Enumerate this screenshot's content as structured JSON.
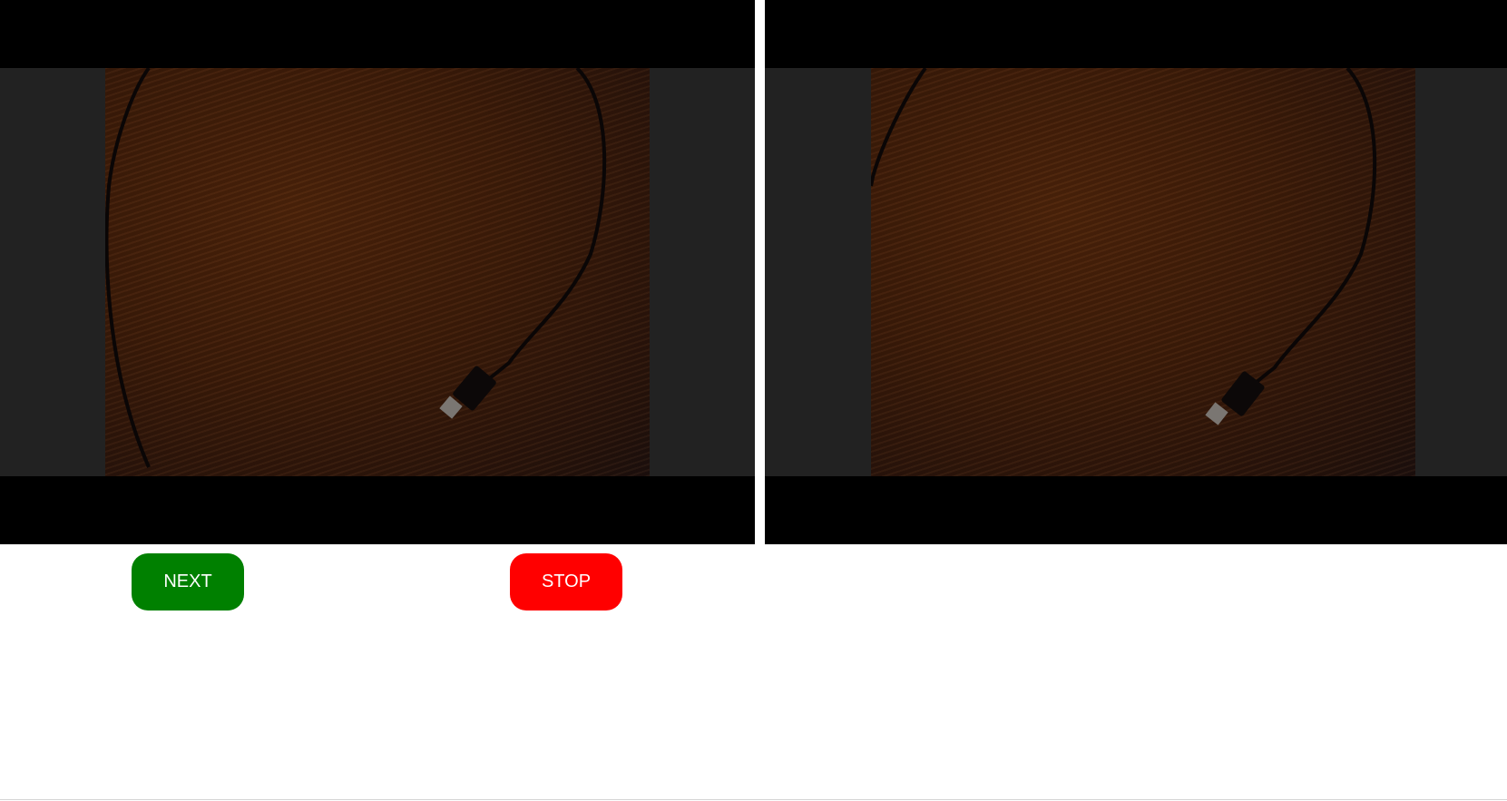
{
  "controls": {
    "next_label": "NEXT",
    "stop_label": "STOP"
  },
  "colors": {
    "next_button": "#008000",
    "stop_button": "#ff0000",
    "video_background": "#000000",
    "video_letterbox": "#222222"
  },
  "videos": [
    {
      "name": "local-video",
      "content": "usb-cable-on-wooden-table"
    },
    {
      "name": "remote-video",
      "content": "usb-cable-on-wooden-table"
    }
  ]
}
